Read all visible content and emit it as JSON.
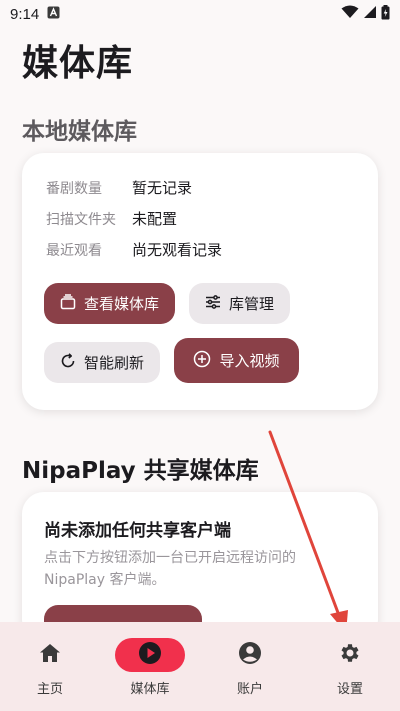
{
  "status_bar": {
    "time": "9:14"
  },
  "page": {
    "title": "媒体库"
  },
  "local_library": {
    "section_title": "本地媒体库",
    "rows": [
      {
        "label": "番剧数量",
        "value": "暂无记录"
      },
      {
        "label": "扫描文件夹",
        "value": "未配置"
      },
      {
        "label": "最近观看",
        "value": "尚无观看记录"
      }
    ],
    "buttons": {
      "view_library": "查看媒体库",
      "library_manage": "库管理",
      "smart_refresh": "智能刷新",
      "import_video": "导入视频"
    }
  },
  "shared_library": {
    "section_title": "NipaPlay 共享媒体库",
    "empty_title": "尚未添加任何共享客户端",
    "empty_desc": "点击下方按钮添加一台已开启远程访问的 NipaPlay 客户端。"
  },
  "bottom_nav": {
    "items": [
      {
        "label": "主页",
        "icon": "home-icon"
      },
      {
        "label": "媒体库",
        "icon": "play-circle-icon",
        "active": true
      },
      {
        "label": "账户",
        "icon": "account-circle-icon"
      },
      {
        "label": "设置",
        "icon": "gear-icon"
      }
    ]
  },
  "colors": {
    "accent": "#8a4048",
    "nav_active": "#f1304c",
    "annotation_arrow": "#e0453b"
  }
}
